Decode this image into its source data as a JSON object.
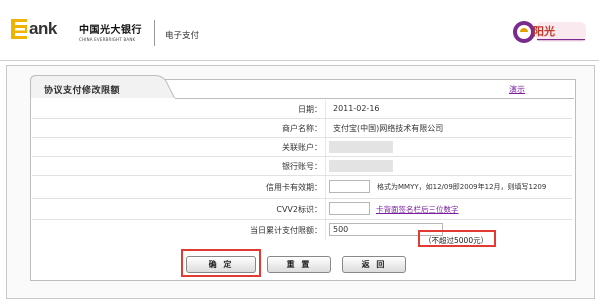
{
  "header": {
    "logo_text": "ank",
    "bank_name_cn": "中国光大银行",
    "bank_name_en": "CHINA EVERBRIGHT BANK",
    "page_title": "电子支付",
    "brand_name": "阳光",
    "accent_color": "#f0b400",
    "brand_color": "#7b2a8e"
  },
  "panel": {
    "tab_title": "协议支付修改限额",
    "demo_link": "演示"
  },
  "form": {
    "date_label": "日期：",
    "date_value": "2011-02-16",
    "merchant_label": "商户名称：",
    "merchant_value": "支付宝(中国)网络技术有限公司",
    "linked_account_label": "关联账户：",
    "bank_account_label": "银行账号：",
    "card_expiry_label": "信用卡有效期：",
    "card_expiry_value": "",
    "card_expiry_hint": "格式为MMYY，如12/09即2009年12月，则填写1209",
    "cvv2_label": "CVV2标识：",
    "cvv2_value": "",
    "cvv2_link": "卡背面签名栏后三位数字",
    "daily_limit_label": "当日累计支付限额：",
    "daily_limit_value": "500",
    "daily_limit_note": "（不超过5000元）"
  },
  "buttons": {
    "confirm": "确 定",
    "reset": "重 置",
    "back": "返 回"
  },
  "highlight_color": "#e23b32"
}
